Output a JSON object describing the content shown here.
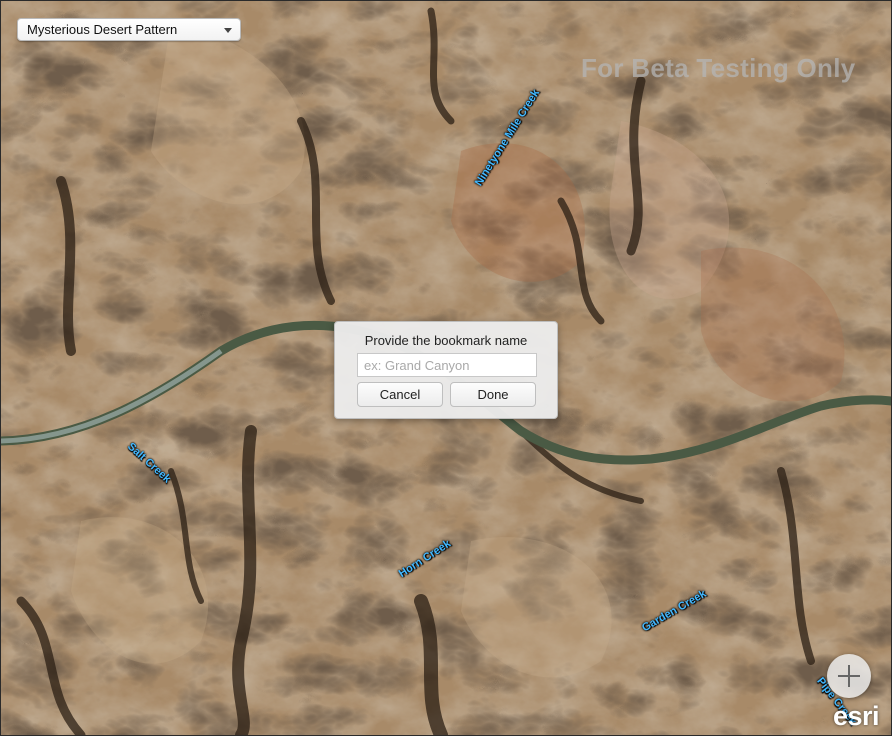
{
  "basemap_select": {
    "value": "Mysterious Desert Pattern"
  },
  "watermark": "For Beta Testing Only",
  "creek_labels": {
    "ninetyone": "Ninetyone Mile Creek",
    "salt": "Salt Creek",
    "horn": "Horn Creek",
    "garden": "Garden Creek",
    "pipe": "Pipe Creek"
  },
  "bookmark_dialog": {
    "title": "Provide the bookmark name",
    "input_value": "",
    "input_placeholder": "ex: Grand Canyon",
    "cancel_label": "Cancel",
    "done_label": "Done"
  },
  "zoom": {
    "icon": "plus-icon"
  },
  "logo_text": "esri",
  "colors": {
    "creek_label": "#42b8ff",
    "river": "#4a5a44"
  }
}
